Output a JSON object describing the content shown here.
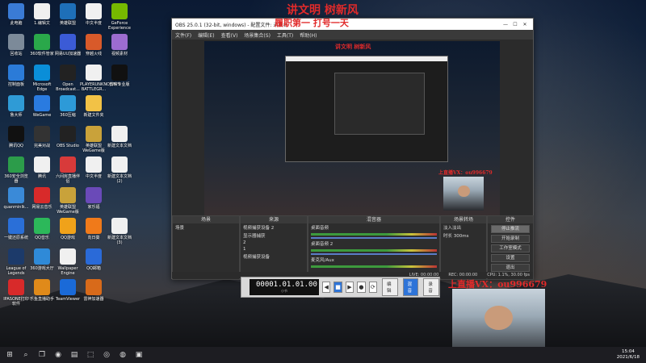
{
  "desktop_icons": [
    {
      "label": "此电脑",
      "color": "#3a7bd5"
    },
    {
      "label": "1.编辑文",
      "color": "#f0f0f0"
    },
    {
      "label": "英雄联盟",
      "color": "#1e6fb8"
    },
    {
      "label": "中文半度",
      "color": "#f0f0f0"
    },
    {
      "label": "GeForce Experience",
      "color": "#76b900"
    },
    {
      "label": "回收站",
      "color": "#7c8a99"
    },
    {
      "label": "360软件管家",
      "color": "#2aa84a"
    },
    {
      "label": "网易UU加速器",
      "color": "#3b5bd6"
    },
    {
      "label": "穿越火线",
      "color": "#d85a2a"
    },
    {
      "label": "视频素材",
      "color": "#9c6cd0"
    },
    {
      "label": "控制面板",
      "color": "#2b7bd8"
    },
    {
      "label": "Microsoft Edge",
      "color": "#0a8ed8"
    },
    {
      "label": "Open Broadcast...",
      "color": "#222"
    },
    {
      "label": "PLAYERUNKNOWN'S BATTLEGR...",
      "color": "#f0f0f0"
    },
    {
      "label": "剪映专业版",
      "color": "#111"
    },
    {
      "label": "鲁大师",
      "color": "#2f9bd6"
    },
    {
      "label": "WeGame",
      "color": "#2a7be0"
    },
    {
      "label": "360压缩",
      "color": "#2d9ad8"
    },
    {
      "label": "新建文件夹",
      "color": "#f2c246"
    },
    {
      "label": "腾讯QQ",
      "color": "#111"
    },
    {
      "label": "完美对战",
      "color": "#333"
    },
    {
      "label": "OBS Studio",
      "color": "#222"
    },
    {
      "label": "英雄联盟WeGame版",
      "color": "#c9a23a"
    },
    {
      "label": "新建文本文档",
      "color": "#f0f0f0"
    },
    {
      "label": "360安全浏览器",
      "color": "#2c9c4a"
    },
    {
      "label": "腾讯",
      "color": "#f0f0f0"
    },
    {
      "label": "六间房直播伴侣",
      "color": "#d83a3a"
    },
    {
      "label": "中文半度",
      "color": "#f0f0f0"
    },
    {
      "label": "新建文本文档 (2)",
      "color": "#f0f0f0"
    },
    {
      "label": "quanminlk...",
      "color": "#3a8ad8"
    },
    {
      "label": "网易云音乐",
      "color": "#d82a2a"
    },
    {
      "label": "英雄联盟WeGame版",
      "color": "#c9a23a"
    },
    {
      "label": "家乐福",
      "color": "#6a4ab8"
    },
    {
      "label": "一键还原系统",
      "color": "#2a6fd8"
    },
    {
      "label": "QQ音乐",
      "color": "#2cb85a"
    },
    {
      "label": "QQ游戏",
      "color": "#f0a21a"
    },
    {
      "label": "向日葵",
      "color": "#f07a1a"
    },
    {
      "label": "新建文本文档 (3)",
      "color": "#f0f0f0"
    },
    {
      "label": "League of Legends",
      "color": "#1c3a6a"
    },
    {
      "label": "360游戏大厅",
      "color": "#2f8ad8"
    },
    {
      "label": "Wallpaper Engine",
      "color": "#f0f0f0"
    },
    {
      "label": "QQ邮箱",
      "color": "#2a6ad8"
    },
    {
      "label": "IPASONE打印软件",
      "color": "#d82a2a"
    },
    {
      "label": "乐鱼直播助手",
      "color": "#e08a1a"
    },
    {
      "label": "TeamViewer",
      "color": "#1a6ad8"
    },
    {
      "label": "雷神加速器",
      "color": "#d86a1a"
    }
  ],
  "obs": {
    "title": "OBS 25.0.1 (32-bit, windows) - 配置文件: 未命名",
    "menu": [
      "文件(F)",
      "编辑(E)",
      "查看(V)",
      "场景集合(S)",
      "工具(T)",
      "帮助(H)"
    ],
    "docks": {
      "scenes": {
        "title": "场景",
        "items": [
          "场景"
        ]
      },
      "sources": {
        "title": "来源",
        "items": [
          "视频捕获设备 2",
          "显示器捕获",
          "2",
          "1",
          "视频捕获设备"
        ]
      },
      "mixer": {
        "title": "混音器",
        "channels": [
          {
            "name": "桌面音频",
            "level": "0.0 dB"
          },
          {
            "name": "桌面音频 2",
            "level": "0.0 dB"
          },
          {
            "name": "麦克风/Aux",
            "level": "0.0 dB"
          }
        ]
      },
      "transitions": {
        "title": "场景转场",
        "type": "淡入淡出",
        "duration_label": "时长",
        "duration": "300ms"
      },
      "controls": {
        "title": "控件",
        "buttons": [
          "停止推流",
          "开始录制",
          "工作室模式",
          "设置",
          "退出"
        ]
      }
    },
    "status": {
      "live": "LIVE: 00:00:00",
      "rec": "REC: 00:00:00",
      "cpu": "CPU: 1.1%, 30.00 fps"
    }
  },
  "overlay": {
    "line1": "讲文明 树新风",
    "line2": "履职第一 打号一天",
    "inner_line": "讲文明 树新风",
    "contact": "上直播VX：ou996679",
    "inner_contact": "上直播VX：ou996679"
  },
  "toolbar": {
    "timer": "00001.01.01.00",
    "timer_sub": "小节",
    "tab1": "编辑",
    "tab2": "混音",
    "tab3": "录音"
  },
  "clock": {
    "time": "15:04",
    "date": "2021/6/18"
  }
}
